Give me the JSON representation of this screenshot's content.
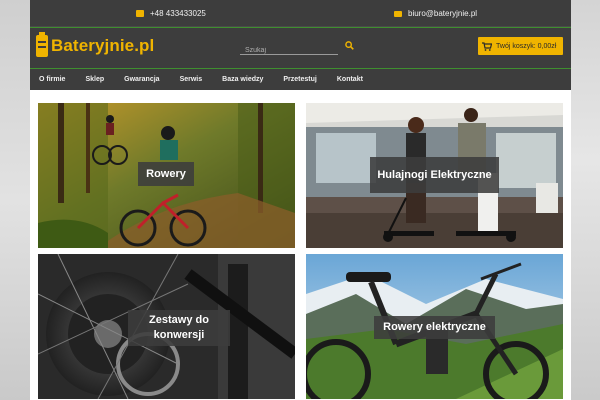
{
  "topbar": {
    "phone": "+48 433433025",
    "phone_icon": "phone-icon",
    "email": "biuro@bateryjnie.pl",
    "email_icon": "mail-icon"
  },
  "header": {
    "logo_text": "Bateryjnie.pl",
    "logo_icon": "battery-icon",
    "search_placeholder": "Szukaj",
    "search_icon": "search-icon",
    "cart_label": "Twój koszyk: 0,00zł",
    "cart_icon": "cart-icon"
  },
  "nav": {
    "items": [
      {
        "label": "O firmie"
      },
      {
        "label": "Sklep"
      },
      {
        "label": "Gwarancja"
      },
      {
        "label": "Serwis"
      },
      {
        "label": "Baza wiedzy"
      },
      {
        "label": "Przetestuj"
      },
      {
        "label": "Kontakt"
      }
    ]
  },
  "tiles": [
    {
      "label": "Rowery"
    },
    {
      "label": "Hulajnogi Elektryczne"
    },
    {
      "label": "Zestawy do konwersji"
    },
    {
      "label": "Rowery elektryczne"
    }
  ],
  "colors": {
    "accent": "#f0b400",
    "dark": "#3d3d3d",
    "green_line": "#3f8f2f"
  }
}
